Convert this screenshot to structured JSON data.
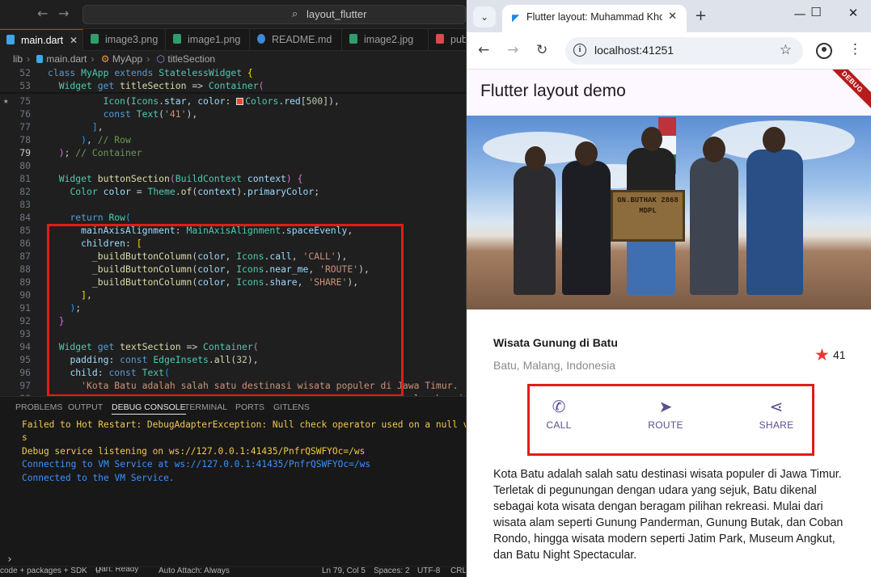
{
  "vscode": {
    "search_text": "layout_flutter",
    "tabs": [
      {
        "label": "main.dart",
        "color": "#3da7e8"
      },
      {
        "label": "image3.png",
        "color": "#2e9e6b"
      },
      {
        "label": "image1.png",
        "color": "#2e9e6b"
      },
      {
        "label": "README.md",
        "color": "#3b8bd6"
      },
      {
        "label": "image2.jpg",
        "color": "#2e9e6b"
      },
      {
        "label": "pub",
        "color": "#d94a4a"
      }
    ],
    "breadcrumb": [
      "lib",
      "main.dart",
      "MyApp",
      "titleSection"
    ],
    "panel_tabs": [
      "PROBLEMS",
      "OUTPUT",
      "DEBUG CONSOLE",
      "TERMINAL",
      "PORTS",
      "GITLENS"
    ],
    "console": [
      {
        "text": "Failed to Hot Restart: DebugAdapterException: Null check operator used on a null value",
        "kind": "err"
      },
      {
        "text": "s",
        "kind": "err"
      },
      {
        "text": "Debug service listening on ws://127.0.0.1:41435/PnfrQSWFYOc=/ws",
        "kind": "err"
      },
      {
        "text": "Connecting to VM Service at ws://127.0.0.1:41435/PnfrQSWFYOc=/ws",
        "kind": "info"
      },
      {
        "text": "Connected to the VM Service.",
        "kind": "info"
      }
    ],
    "status": {
      "left": "code + packages + SDK",
      "dart": "Dart: Ready",
      "attach": "Auto Attach: Always",
      "position": "Ln 79, Col 5",
      "spaces": "Spaces: 2",
      "encoding": "UTF-8",
      "eol": "CRLF"
    }
  },
  "browser": {
    "tab_title": "Flutter layout: Muhammad Khoirul",
    "url": "localhost:41251"
  },
  "app": {
    "appbar_title": "Flutter layout demo",
    "debug_banner": "DEBUG",
    "sign_text": "GN.BUTHAK 2868 MDPL",
    "place_name": "Wisata Gunung di Batu",
    "place_location": "Batu, Malang, Indonesia",
    "star_count": "41",
    "buttons": [
      {
        "label": "CALL",
        "icon": "phone-icon"
      },
      {
        "label": "ROUTE",
        "icon": "near-me-icon"
      },
      {
        "label": "SHARE",
        "icon": "share-icon"
      }
    ],
    "accent_color": "#5e4d92",
    "description": "Kota Batu adalah salah satu destinasi wisata populer di Jawa Timur. Terletak di pegunungan dengan udara yang sejuk, Batu dikenal sebagai kota wisata dengan beragam pilihan rekreasi. Mulai dari wisata alam seperti Gunung Panderman, Gunung Butak, dan Coban Rondo, hingga wisata modern seperti Jatim Park, Museum Angkut, dan Batu Night Spectacular."
  }
}
